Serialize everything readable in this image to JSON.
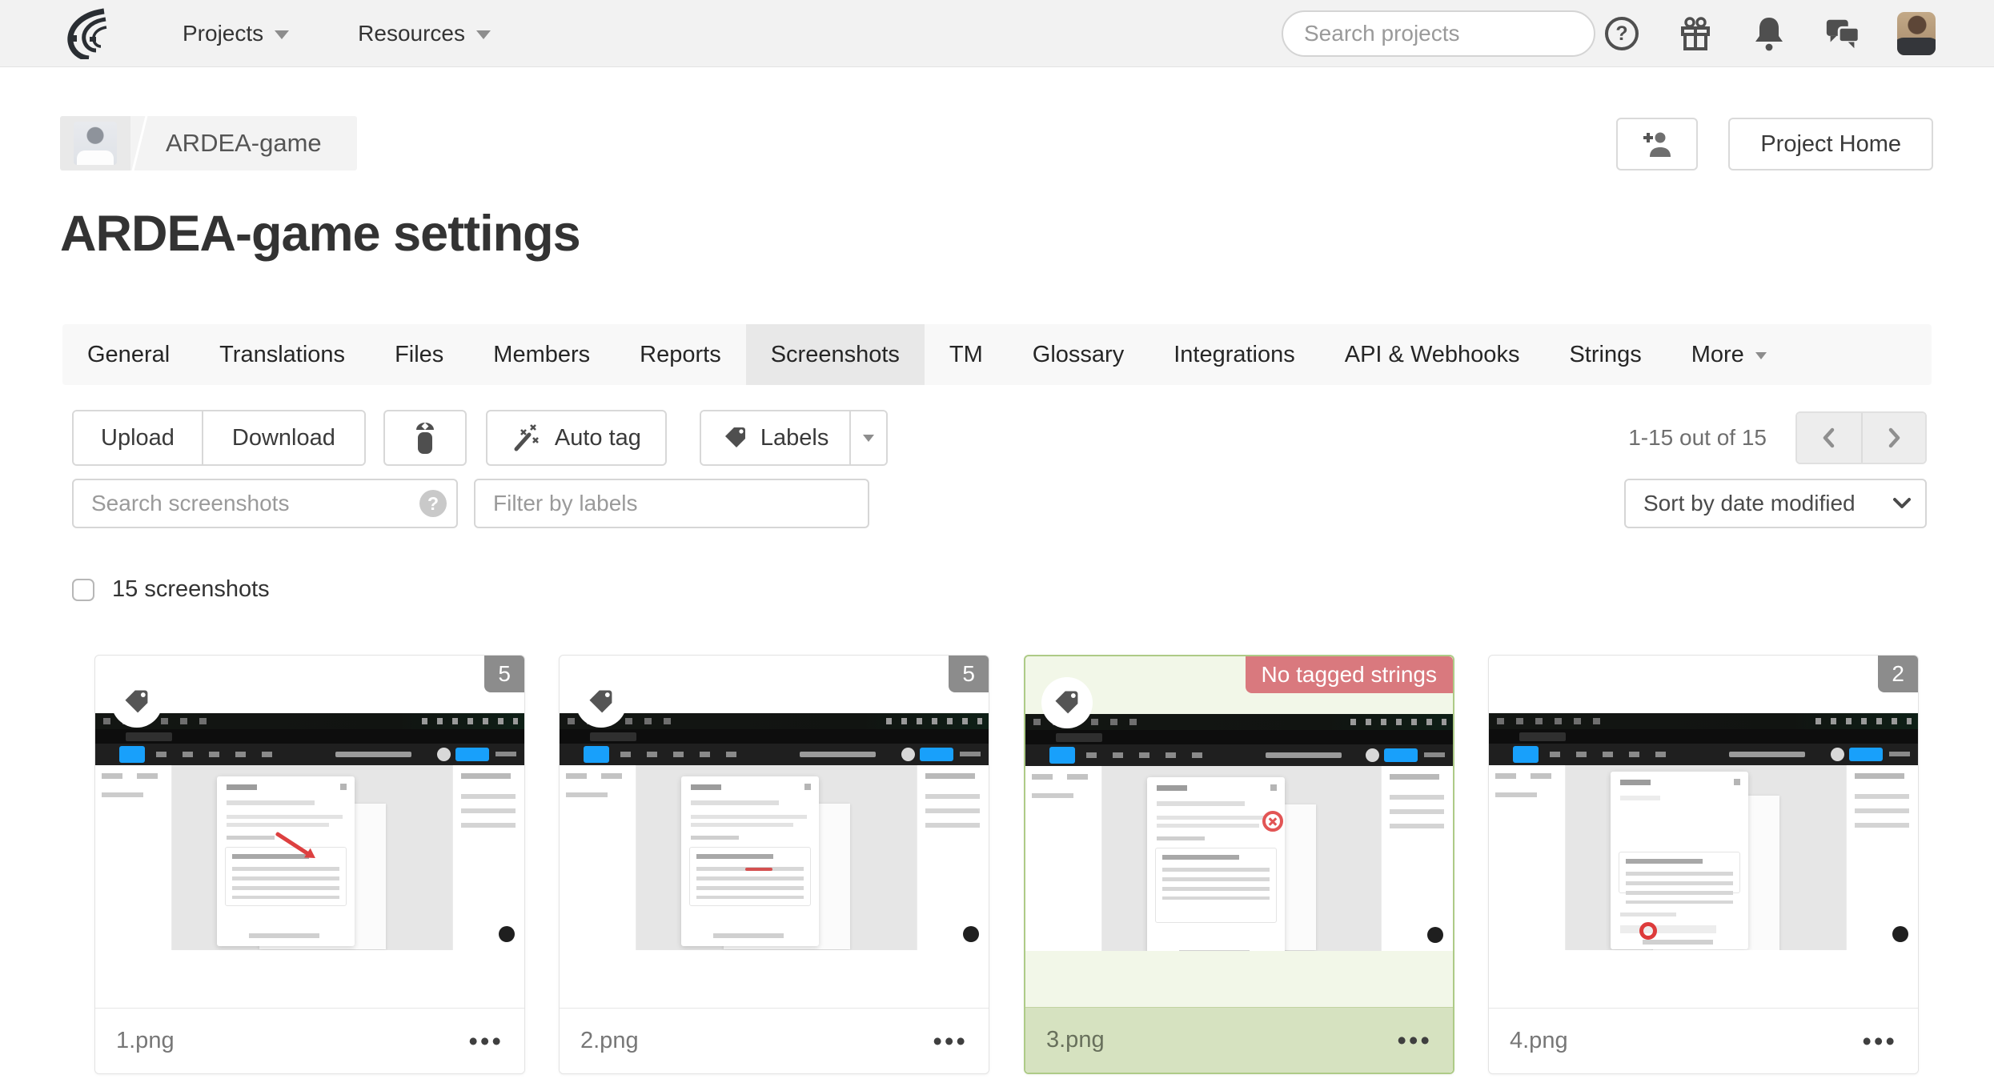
{
  "nav": {
    "projects_label": "Projects",
    "resources_label": "Resources",
    "search_placeholder": "Search projects",
    "icons": [
      "help-icon",
      "gifts-icon",
      "notifications-icon",
      "messages-icon",
      "user-avatar"
    ]
  },
  "breadcrumb": {
    "project_name": "ARDEA-game"
  },
  "header_actions": {
    "project_home_label": "Project Home",
    "invite_icon": "add-person-icon"
  },
  "page": {
    "title": "ARDEA-game settings"
  },
  "tabs": {
    "items": [
      "General",
      "Translations",
      "Files",
      "Members",
      "Reports",
      "Screenshots",
      "TM",
      "Glossary",
      "Integrations",
      "API & Webhooks",
      "Strings",
      "More"
    ],
    "active": "Screenshots"
  },
  "toolbar": {
    "upload_label": "Upload",
    "download_label": "Download",
    "delete_icon": "trash-icon",
    "auto_tag_label": "Auto tag",
    "labels_label": "Labels",
    "pagination": "1-15 out of 15"
  },
  "filters": {
    "search_placeholder": "Search screenshots",
    "search_help": "?",
    "labels_placeholder": "Filter by labels",
    "sort_value": "Sort by date modified"
  },
  "selection": {
    "count_label": "15 screenshots"
  },
  "cards_ui": {
    "menu": "•••"
  },
  "cards": [
    {
      "filename": "1.png",
      "badge": "5",
      "badge_type": "count",
      "has_tag_icon": true,
      "selected": false
    },
    {
      "filename": "2.png",
      "badge": "5",
      "badge_type": "count",
      "has_tag_icon": true,
      "selected": false
    },
    {
      "filename": "3.png",
      "badge": "No tagged strings",
      "badge_type": "warning",
      "has_tag_icon": true,
      "selected": true
    },
    {
      "filename": "4.png",
      "badge": "2",
      "badge_type": "count",
      "has_tag_icon": false,
      "selected": false
    }
  ],
  "colors": {
    "accent_blue": "#18a0fb",
    "selected_green_border": "#aecb87",
    "selected_green_bg": "#d6e2c0",
    "warning_badge": "#d9797e",
    "count_badge": "#8c8c8c"
  }
}
